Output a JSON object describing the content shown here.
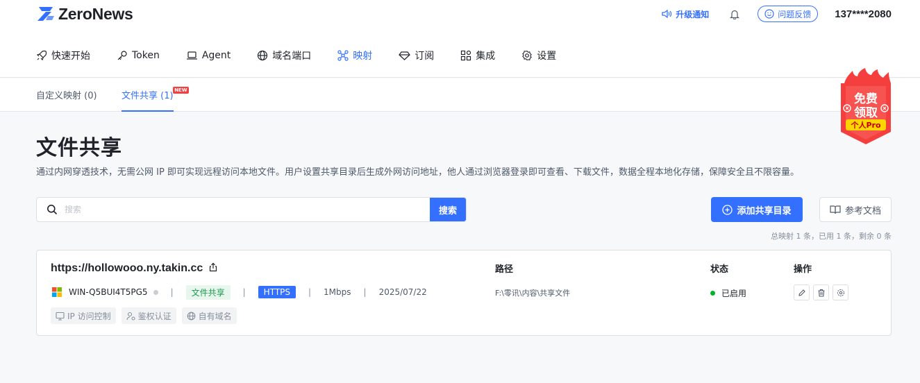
{
  "brand": {
    "name": "ZeroNews"
  },
  "header": {
    "upgrade_label": "升级通知",
    "feedback_label": "问题反馈",
    "account": "137****2080"
  },
  "nav": {
    "items": [
      {
        "label": "快速开始",
        "icon": "rocket-icon"
      },
      {
        "label": "Token",
        "icon": "key-icon"
      },
      {
        "label": "Agent",
        "icon": "laptop-icon"
      },
      {
        "label": "域名端口",
        "icon": "globe-icon"
      },
      {
        "label": "映射",
        "icon": "mapping-icon",
        "active": true
      },
      {
        "label": "订阅",
        "icon": "diamond-icon"
      },
      {
        "label": "集成",
        "icon": "integration-icon"
      },
      {
        "label": "设置",
        "icon": "gear-icon"
      }
    ]
  },
  "subtabs": {
    "custom": "自定义映射 (0)",
    "share": "文件共享 (1)",
    "new_badge": "NEW"
  },
  "promo": {
    "line1": "免费",
    "line2": "领取",
    "ribbon": "个人Pro"
  },
  "page": {
    "title": "文件共享",
    "description": "通过内网穿透技术，无需公网 IP 即可实现远程访问本地文件。用户设置共享目录后生成外网访问地址，他人通过浏览器登录即可查看、下载文件，数据全程本地化存储，保障安全且不限容量。"
  },
  "search": {
    "placeholder": "搜索",
    "button": "搜索"
  },
  "actions": {
    "add": "添加共享目录",
    "docs": "参考文档"
  },
  "summary": "总映射 1 条，已用 1 条，剩余 0 条",
  "columns": {
    "path": "路径",
    "status": "状态",
    "ops": "操作"
  },
  "share": {
    "url": "https://hollowooo.ny.takin.cc",
    "agent": "WIN-Q5BUI4T5PG5",
    "type_tag": "文件共享",
    "protocol": "HTTPS",
    "bandwidth": "1Mbps",
    "date": "2025/07/22",
    "path": "F:\\零讯\\内容\\共享文件",
    "status": "已启用",
    "features": [
      "IP 访问控制",
      "鉴权认证",
      "自有域名"
    ]
  },
  "colors": {
    "accent": "#3370ff",
    "success": "#00b42a",
    "promo": "#f53f3f"
  }
}
